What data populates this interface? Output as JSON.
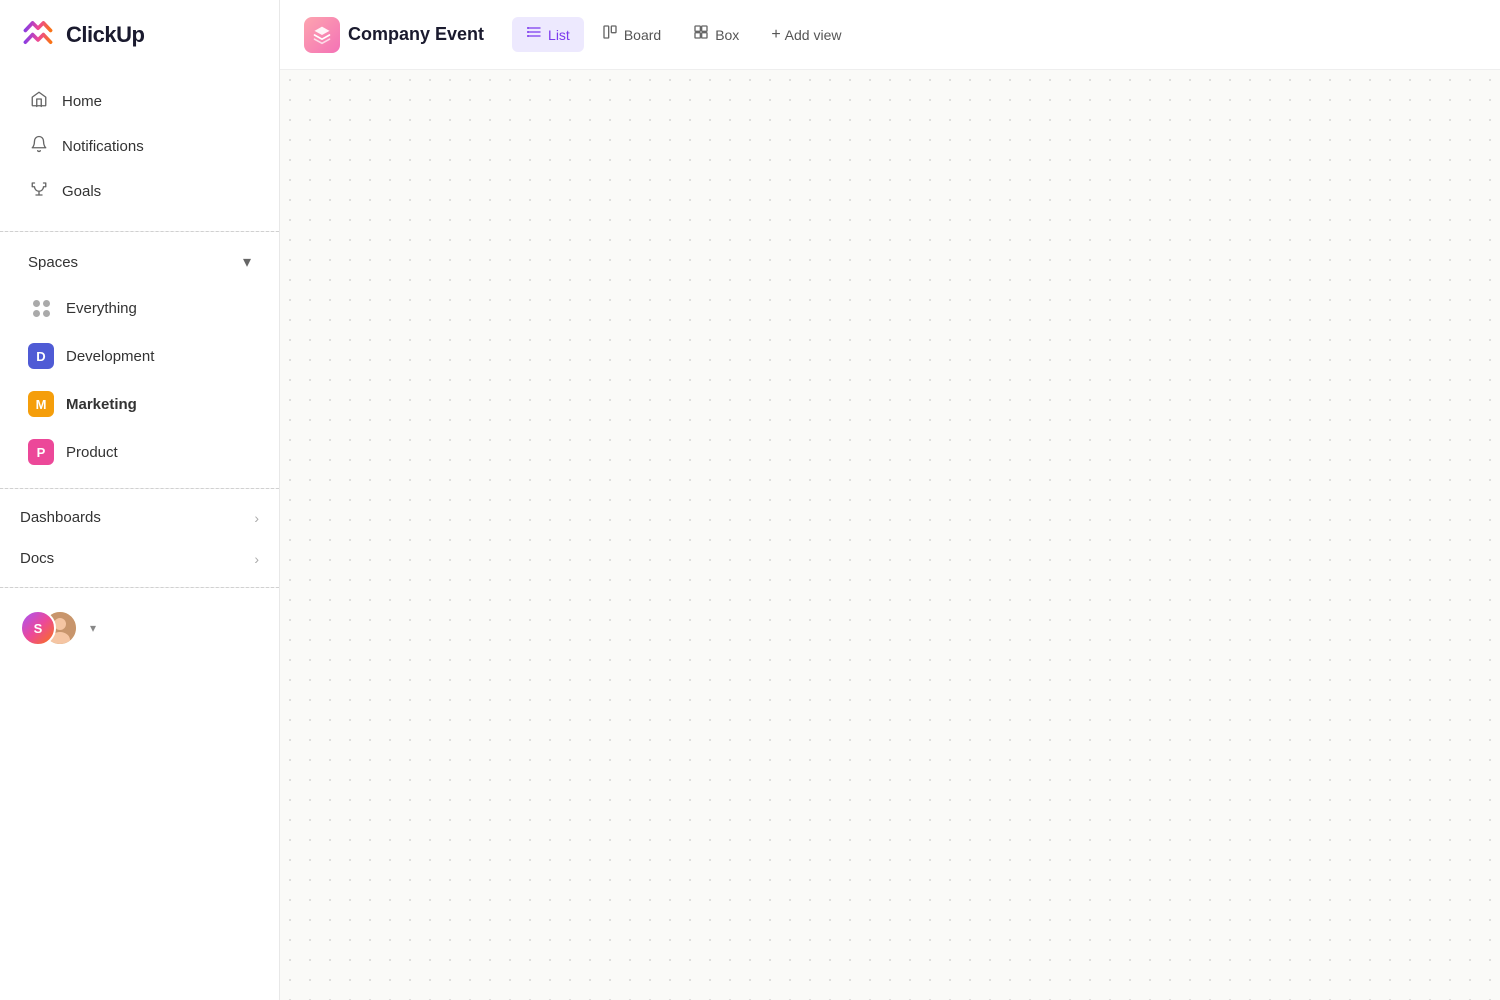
{
  "app": {
    "name": "ClickUp"
  },
  "sidebar": {
    "logo_text": "ClickUp",
    "nav_items": [
      {
        "id": "home",
        "label": "Home",
        "icon": "home"
      },
      {
        "id": "notifications",
        "label": "Notifications",
        "icon": "bell"
      },
      {
        "id": "goals",
        "label": "Goals",
        "icon": "trophy"
      }
    ],
    "spaces_section": {
      "label": "Spaces",
      "items": [
        {
          "id": "everything",
          "label": "Everything",
          "type": "dots"
        },
        {
          "id": "development",
          "label": "Development",
          "type": "avatar",
          "initial": "D",
          "color": "#4f5bd5"
        },
        {
          "id": "marketing",
          "label": "Marketing",
          "type": "avatar",
          "initial": "M",
          "color": "#f59e0b",
          "bold": true
        },
        {
          "id": "product",
          "label": "Product",
          "type": "avatar",
          "initial": "P",
          "color": "#ec4899"
        }
      ]
    },
    "bottom_sections": [
      {
        "id": "dashboards",
        "label": "Dashboards"
      },
      {
        "id": "docs",
        "label": "Docs"
      }
    ],
    "user": {
      "initials": "S",
      "chevron": "▾"
    }
  },
  "topbar": {
    "project_title": "Company Event",
    "views": [
      {
        "id": "list",
        "label": "List",
        "icon": "list",
        "active": true
      },
      {
        "id": "board",
        "label": "Board",
        "icon": "board",
        "active": false
      },
      {
        "id": "box",
        "label": "Box",
        "icon": "box",
        "active": false
      }
    ],
    "add_view_label": "Add view"
  }
}
